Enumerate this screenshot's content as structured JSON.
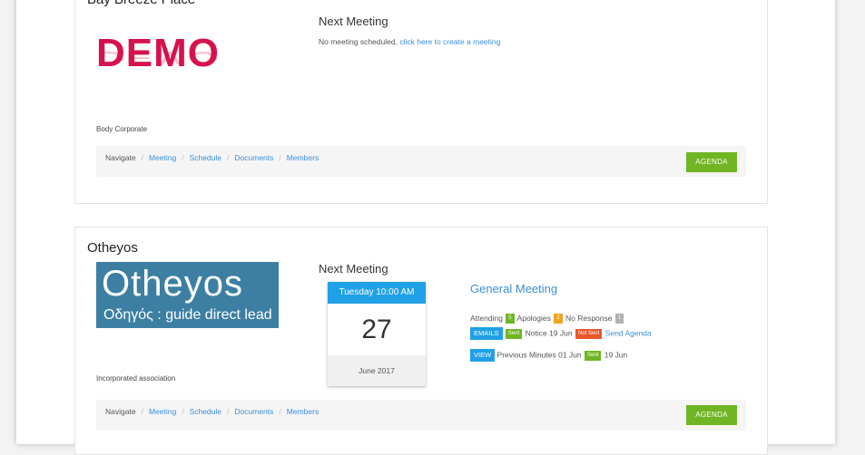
{
  "cards": [
    {
      "title": "Bay Breeze Place",
      "logo_text": "DEMO",
      "org_type": "Body Corporate",
      "next_meeting_heading": "Next Meeting",
      "no_meeting_text": "No meeting scheduled,",
      "create_link": "click here to create a meeting",
      "nav": {
        "label": "Navigate",
        "items": [
          "Meeting",
          "Schedule",
          "Documents",
          "Members"
        ]
      },
      "agenda_label": "AGENDA"
    },
    {
      "title": "Otheyos",
      "logo_main": "Otheyos",
      "logo_sub": "Οδηγός : guide direct lead",
      "org_type": "Incorporated association",
      "next_meeting_heading": "Next Meeting",
      "calendar": {
        "header": "Tuesday 10:00 AM",
        "day": "27",
        "month": "June 2017"
      },
      "meeting_title": "General Meeting",
      "attending_label": "Attending",
      "attending_count": "5",
      "apologies_label": "Apologies",
      "apologies_count": "2",
      "no_response_label": "No Response",
      "no_response_count": "1",
      "emails_tag": "EMAILS",
      "sent_badge": "Sent",
      "notice_text": "Notice 19 Jun",
      "not_sent_badge": "Not Sent",
      "send_agenda_link": "Send Agenda",
      "view_tag": "VIEW",
      "previous_minutes_text": "Previous Minutes 01 Jun",
      "minutes_sent_badge": "Sent",
      "minutes_sent_date": "19 Jun",
      "nav": {
        "label": "Navigate",
        "items": [
          "Meeting",
          "Schedule",
          "Documents",
          "Members"
        ]
      },
      "agenda_label": "AGENDA"
    }
  ],
  "colors": {
    "accent": "#3a8fd9",
    "agenda_green": "#6fb524",
    "calendar_blue": "#20a0e6",
    "demo_red": "#d6124d"
  }
}
